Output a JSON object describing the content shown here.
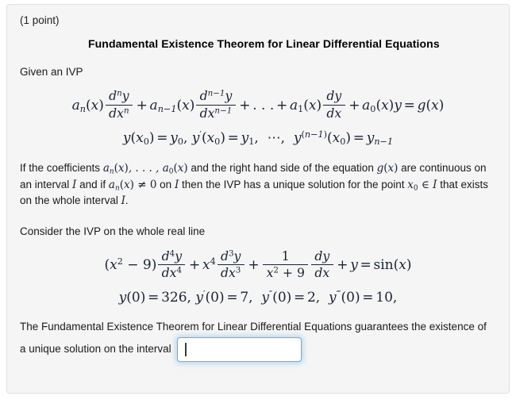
{
  "page": {
    "background_color": "#ffffff",
    "card_background_color": "#f5f5f5",
    "card_border_color": "#e0e0e0"
  },
  "problem": {
    "points_label": "(1 point)",
    "theorem_title": "Fundamental Existence Theorem for Linear Differential Equations",
    "given_label": "Given an IVP",
    "general_ode": {
      "a_n": "a",
      "a_n_sub": "n",
      "x_var": "(x)",
      "d_num_1": "d",
      "d_num_1_sup": "n",
      "y_var": "y",
      "d_den_1": "dx",
      "d_den_1_sup": "n",
      "a_nm1_sub": "n−1",
      "d_num_2_sup": "n−1",
      "d_den_2_sup": "n−1",
      "ellipsis": "+ . . . +",
      "a_1_sub": "1",
      "dy": "dy",
      "dx": "dx",
      "a_0_sub": "0",
      "rhs": "g(x)"
    },
    "general_initial_conditions": {
      "text": "y(x₀) = y₀, y′(x₀) = y₁, ⋯, y^(n−1)(x₀) = yₙ₋₁"
    },
    "theorem_statement": {
      "part1": "If the coefficients ",
      "coeff_list": "aₙ(x), . . . , a₀(x)",
      "part2": " and the right hand side of the equation ",
      "g_of_x": "g(x)",
      "part3": " are continuous on an interval ",
      "interval_I": "I",
      "part4": " and if ",
      "an_nonzero": "aₙ(x) ≠ 0",
      "part5": " on ",
      "part6": " then the IVP has a unique solution for the point ",
      "x0_in_I": "x₀ ∈ I",
      "part7": " that exists on the whole interval ",
      "part8": "."
    },
    "consider_label": "Consider the IVP on the whole real line",
    "specific_ode": {
      "coefficient_4": "(x² − 9)",
      "term_4_num": "d⁴y",
      "term_4_den": "dx⁴",
      "coefficient_3": "x⁴",
      "term_3_num": "d³y",
      "term_3_den": "dx³",
      "coefficient_1_num": "1",
      "coefficient_1_den": "x² + 9",
      "term_1_num": "dy",
      "term_1_den": "dx",
      "term_0": "+ y",
      "equals": "=",
      "rhs": "sin(x)"
    },
    "specific_initial_conditions": {
      "y0": "326",
      "y1": "7",
      "y2": "2",
      "y3": "10",
      "text": "y(0) = 326, y′(0) = 7, y″(0) = 2, y‴(0) = 10,"
    },
    "answer_prompt": {
      "line1": "The Fundamental Existence Theorem for Linear Differential Equations guarantees the existence of",
      "line2": "a unique solution on the interval",
      "input_value": "",
      "input_placeholder": "",
      "input_focused": true,
      "focus_color": "#66afe9"
    }
  }
}
